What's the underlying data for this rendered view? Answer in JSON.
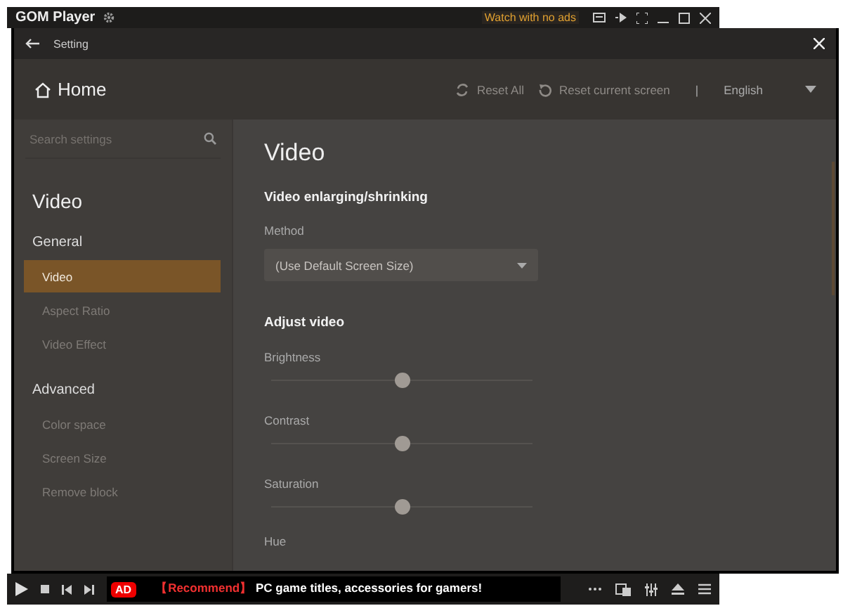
{
  "app_bar": {
    "title": "GOM Player",
    "promo": "Watch with no ads"
  },
  "settings": {
    "title": "Setting",
    "home": "Home",
    "reset_all": "Reset All",
    "reset_screen": "Reset current screen",
    "separator": "|",
    "language": "English"
  },
  "sidebar": {
    "search_placeholder": "Search settings",
    "heading": "Video",
    "groups": [
      {
        "label": "General",
        "items": [
          {
            "label": "Video",
            "selected": true
          },
          {
            "label": "Aspect Ratio",
            "selected": false
          },
          {
            "label": "Video Effect",
            "selected": false
          }
        ]
      },
      {
        "label": "Advanced",
        "items": [
          {
            "label": "Color space",
            "selected": false
          },
          {
            "label": "Screen Size",
            "selected": false
          },
          {
            "label": "Remove block",
            "selected": false
          }
        ]
      }
    ]
  },
  "content": {
    "title": "Video",
    "section_1": "Video enlarging/shrinking",
    "method_label": "Method",
    "method_value": "(Use Default Screen Size)",
    "section_2": "Adjust video",
    "sliders": [
      {
        "label": "Brightness",
        "level": 0.5
      },
      {
        "label": "Contrast",
        "level": 0.5
      },
      {
        "label": "Saturation",
        "level": 0.5
      }
    ],
    "cut_label": "Hue"
  },
  "control_bar": {
    "ad_badge": "AD",
    "ad_tag": "【Recommend】",
    "ad_text": "PC game titles, accessories for gamers!"
  }
}
